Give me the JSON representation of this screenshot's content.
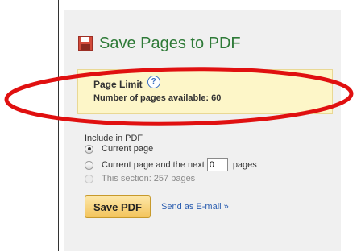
{
  "dialog": {
    "title": "Save Pages to PDF",
    "icon": "save-floppy-icon"
  },
  "page_limit": {
    "label": "Page Limit",
    "help_icon": "?",
    "available_text": "Number of pages available: 60"
  },
  "include": {
    "label": "Include in PDF",
    "options": [
      {
        "label": "Current page",
        "checked": true,
        "enabled": true
      },
      {
        "label_before": "Current page and the next",
        "input_value": "0",
        "label_after": "pages",
        "checked": false,
        "enabled": true
      },
      {
        "label": "This section: 257 pages",
        "checked": false,
        "enabled": false
      }
    ]
  },
  "actions": {
    "save_label": "Save PDF",
    "email_label": "Send as E-mail »"
  },
  "colors": {
    "title_green": "#2e7a37",
    "highlight_yellow": "#fdf6c8",
    "annotation_red": "#e01010",
    "link_blue": "#2a5db0"
  }
}
